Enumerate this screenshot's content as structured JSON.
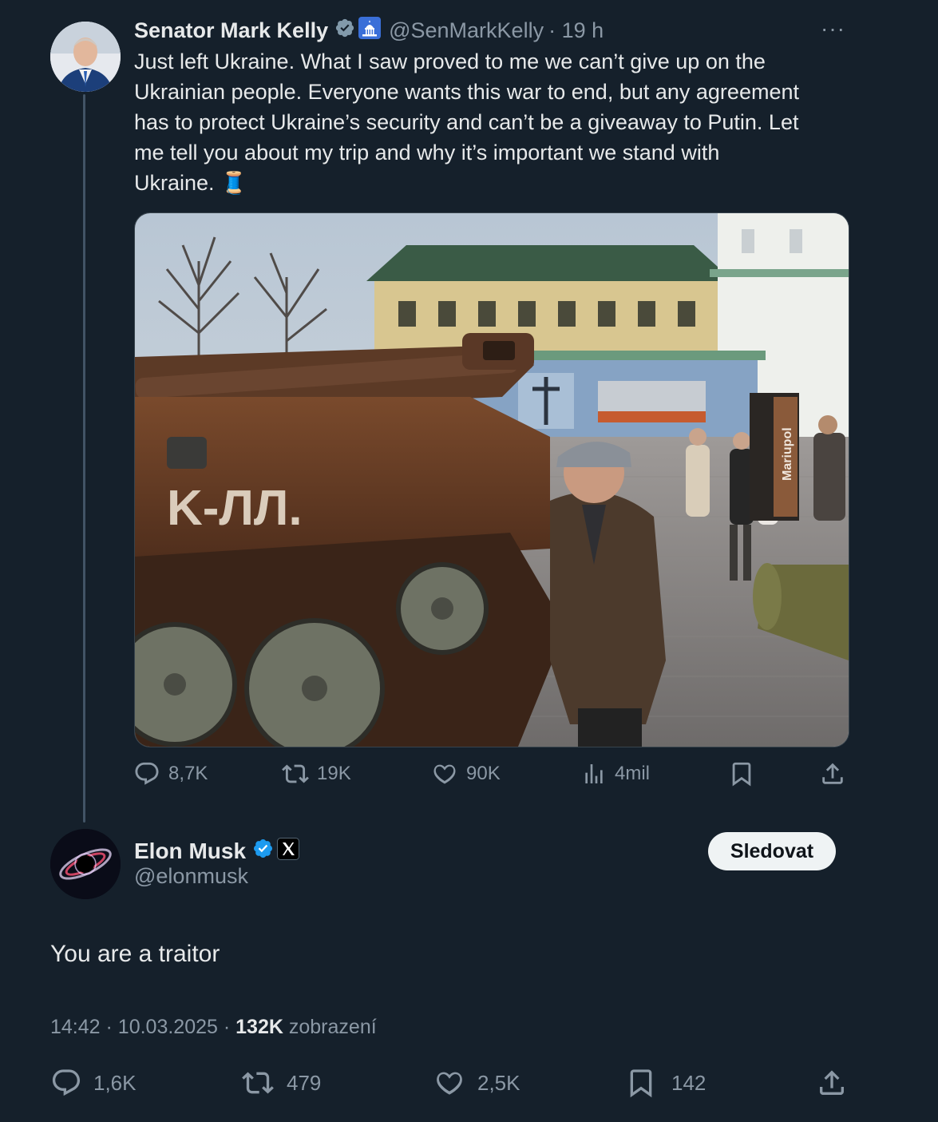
{
  "parent_tweet": {
    "author_name": "Senator Mark Kelly",
    "handle": "@SenMarkKelly",
    "time": "· 19 h",
    "more_label": "···",
    "text_lines": [
      "Just left Ukraine. What I saw proved to me we can’t give up on the",
      "Ukrainian people. Everyone wants this war to end, but any agreement",
      "has to protect Ukraine’s security and can’t be a giveaway to Putin. Let",
      "me tell you about my trip and why it’s important we stand with",
      "Ukraine. 🧵"
    ],
    "photo_sign_text": "Mariupol",
    "tank_graffiti": "K-ЛЛ.",
    "stats": {
      "replies": "8,7K",
      "reposts": "19K",
      "likes": "90K",
      "views": "4mil"
    }
  },
  "reply": {
    "author_name": "Elon Musk",
    "handle": "@elonmusk",
    "follow_label": "Sledovat",
    "text": "You are a traitor",
    "time": "14:42",
    "date": "10.03.2025",
    "views_count": "132K",
    "views_label": "zobrazení",
    "stats": {
      "replies": "1,6K",
      "reposts": "479",
      "likes": "2,5K",
      "bookmarks": "142"
    }
  },
  "colors": {
    "background": "#15202b",
    "text": "#e7e9ea",
    "muted": "#8b98a5",
    "verified_gray": "#829aab",
    "verified_blue": "#1d9bf0"
  }
}
